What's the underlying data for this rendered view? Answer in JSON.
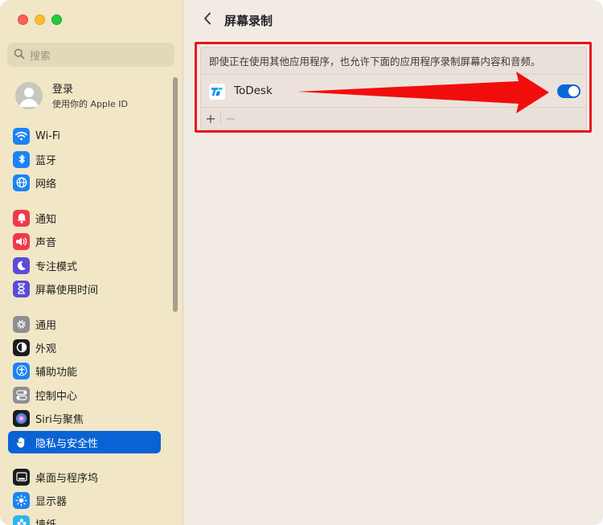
{
  "window": {
    "title": "屏幕录制"
  },
  "search": {
    "placeholder": "搜索"
  },
  "account": {
    "name": "登录",
    "subtitle": "使用你的 Apple ID"
  },
  "sidebar": {
    "items": [
      {
        "label": "Wi-Fi",
        "icon": "wifi-icon",
        "color": "#1a83f5",
        "selected": false
      },
      {
        "label": "蓝牙",
        "icon": "bluetooth-icon",
        "color": "#1a83f5",
        "selected": false
      },
      {
        "label": "网络",
        "icon": "globe-icon",
        "color": "#1a83f5",
        "selected": false
      },
      {
        "label": "通知",
        "icon": "bell-icon",
        "color": "#f0394a",
        "selected": false
      },
      {
        "label": "声音",
        "icon": "speaker-icon",
        "color": "#f0394a",
        "selected": false
      },
      {
        "label": "专注模式",
        "icon": "moon-icon",
        "color": "#5b4bd6",
        "selected": false
      },
      {
        "label": "屏幕使用时间",
        "icon": "hourglass-icon",
        "color": "#5b4bd6",
        "selected": false
      },
      {
        "label": "通用",
        "icon": "gear-icon",
        "color": "#8e8e93",
        "selected": false
      },
      {
        "label": "外观",
        "icon": "appearance-icon",
        "color": "#1c1c1e",
        "selected": false
      },
      {
        "label": "辅助功能",
        "icon": "accessibility-icon",
        "color": "#1a83f5",
        "selected": false
      },
      {
        "label": "控制中心",
        "icon": "control-center-icon",
        "color": "#8e8e93",
        "selected": false
      },
      {
        "label": "Siri与聚焦",
        "icon": "siri-icon",
        "color": "#1c1c1e",
        "selected": false
      },
      {
        "label": "隐私与安全性",
        "icon": "hand-icon",
        "color": "#1a83f5",
        "selected": true
      },
      {
        "label": "桌面与程序坞",
        "icon": "dock-icon",
        "color": "#1c1c1e",
        "selected": false
      },
      {
        "label": "显示器",
        "icon": "sun-icon",
        "color": "#1a83f5",
        "selected": false
      },
      {
        "label": "墙纸",
        "icon": "wallpaper-icon",
        "color": "#2ab4f0",
        "selected": false
      }
    ]
  },
  "main": {
    "description": "即使正在使用其他应用程序，也允许下面的应用程序录制屏幕内容和音频。",
    "apps": [
      {
        "name": "ToDesk",
        "icon": "todesk-icon",
        "enabled": true
      }
    ],
    "add_label": "+",
    "remove_label": "−"
  },
  "colors": {
    "accent": "#0a63d4",
    "highlight": "#e8131c",
    "sidebar_bg": "#f1e7c6",
    "main_bg": "#f2ebe4"
  }
}
